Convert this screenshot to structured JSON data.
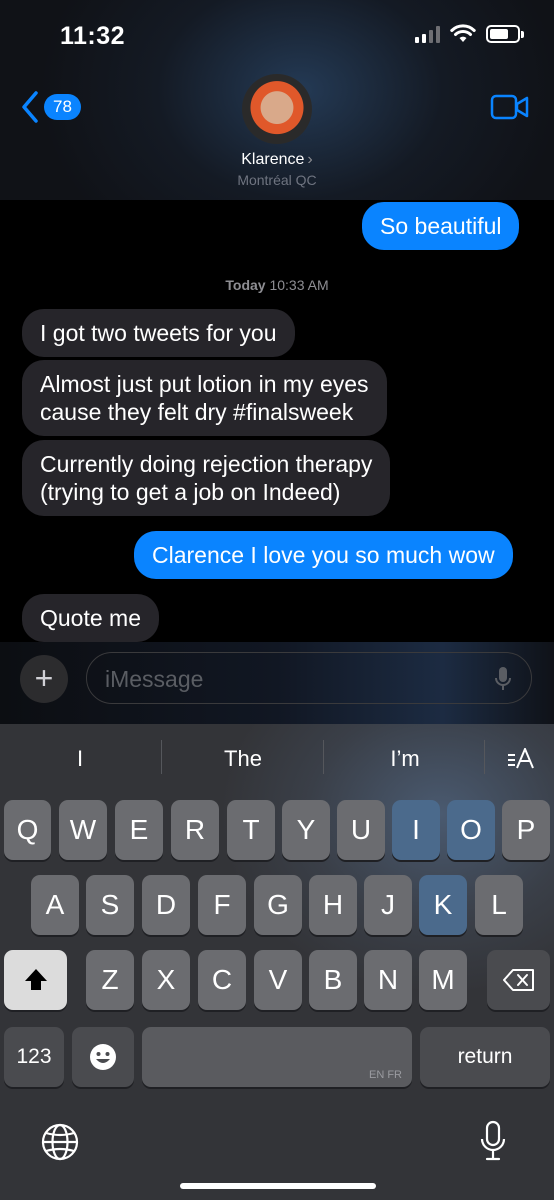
{
  "status_bar": {
    "time": "11:32"
  },
  "header": {
    "back_count": "78",
    "contact_name": "Klarence",
    "contact_location": "Montréal QC"
  },
  "messages": [
    {
      "direction": "outgoing",
      "text": "So beautiful"
    },
    {
      "direction": "incoming",
      "text": "I got two tweets for you"
    },
    {
      "direction": "incoming",
      "lines": [
        "Almost just put lotion in my eyes",
        "cause they felt dry #finalsweek"
      ]
    },
    {
      "direction": "incoming",
      "lines": [
        "Currently doing rejection therapy",
        "(trying to get a job on Indeed)"
      ]
    },
    {
      "direction": "outgoing",
      "text": "Clarence I love you so much wow"
    },
    {
      "direction": "incoming",
      "text": "Quote me"
    }
  ],
  "timestamp": {
    "day": "Today",
    "time": "10:33 AM"
  },
  "input": {
    "placeholder": "iMessage"
  },
  "keyboard": {
    "predictions": [
      "I",
      "The",
      "I’m"
    ],
    "row1": [
      "Q",
      "W",
      "E",
      "R",
      "T",
      "Y",
      "U",
      "I",
      "O",
      "P"
    ],
    "row2": [
      "A",
      "S",
      "D",
      "F",
      "G",
      "H",
      "J",
      "K",
      "L"
    ],
    "row3": [
      "Z",
      "X",
      "C",
      "V",
      "B",
      "N",
      "M"
    ],
    "numbers_label": "123",
    "return_label": "return",
    "space_hint": "EN FR",
    "icons": [
      "shift-icon",
      "delete-icon",
      "emoji-icon",
      "globe-icon",
      "microphone-icon",
      "text-format-icon"
    ]
  }
}
